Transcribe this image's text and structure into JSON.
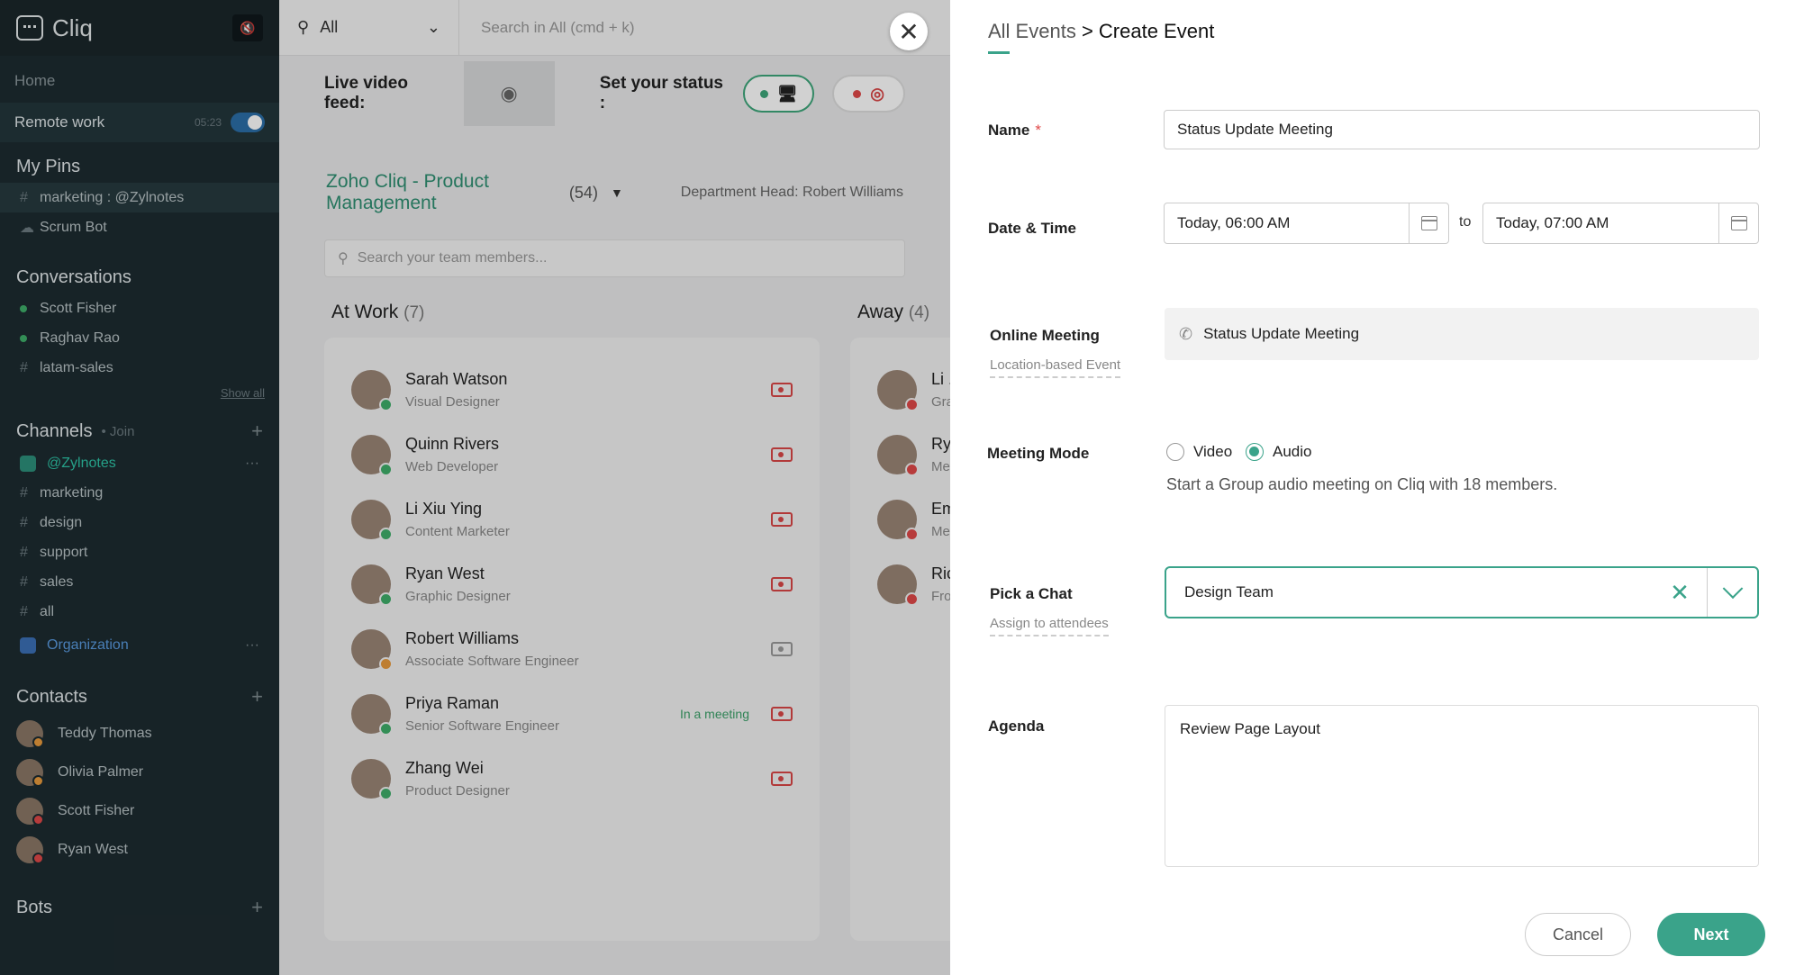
{
  "app": {
    "name": "Cliq"
  },
  "sidebar": {
    "home": "Home",
    "remote": {
      "label": "Remote work",
      "time": "05:23"
    },
    "pins": {
      "title": "My Pins",
      "items": [
        {
          "prefix": "#",
          "label": "marketing : @Zylnotes"
        },
        {
          "prefix": "☁",
          "label": "Scrum Bot"
        }
      ]
    },
    "conversations": {
      "title": "Conversations",
      "items": [
        {
          "label": "Scott Fisher"
        },
        {
          "label": "Raghav Rao"
        },
        {
          "label": "latam-sales"
        }
      ],
      "show_all": "Show all"
    },
    "channels": {
      "title": "Channels",
      "join": "• Join",
      "team": "@Zylnotes",
      "items": [
        "marketing",
        "design",
        "support",
        "sales",
        "all"
      ],
      "org": "Organization"
    },
    "contacts": {
      "title": "Contacts",
      "items": [
        "Teddy Thomas",
        "Olivia Palmer",
        "Scott Fisher",
        "Ryan West"
      ]
    },
    "bots": {
      "title": "Bots"
    }
  },
  "topbar": {
    "scope": "All",
    "search_placeholder": "Search in All (cmd + k)"
  },
  "statusbar": {
    "live_video": "Live video feed:",
    "set_status": "Set your status :"
  },
  "team": {
    "name": "Zoho Cliq - Product Management",
    "count": "(54)",
    "dept": "Department Head: Robert Williams",
    "search_placeholder": "Search your team members..."
  },
  "at_work": {
    "title": "At Work",
    "count": "(7)",
    "members": [
      {
        "name": "Sarah Watson",
        "role": "Visual Designer",
        "status": ""
      },
      {
        "name": "Quinn Rivers",
        "role": "Web Developer",
        "status": ""
      },
      {
        "name": "Li Xiu Ying",
        "role": "Content Marketer",
        "status": ""
      },
      {
        "name": "Ryan West",
        "role": "Graphic Designer",
        "status": ""
      },
      {
        "name": "Robert Williams",
        "role": "Associate Software Engineer",
        "status": ""
      },
      {
        "name": "Priya Raman",
        "role": "Senior Software Engineer",
        "status": "In a meeting"
      },
      {
        "name": "Zhang Wei",
        "role": "Product Designer",
        "status": ""
      }
    ]
  },
  "away": {
    "title": "Away",
    "count": "(4)",
    "members": [
      {
        "name": "Li .",
        "role": "Gra"
      },
      {
        "name": "Ry",
        "role": "Me"
      },
      {
        "name": "Em",
        "role": "Me"
      },
      {
        "name": "Ric",
        "role": "Fro"
      }
    ]
  },
  "panel": {
    "breadcrumb_parent": "All Events",
    "breadcrumb_sep": " > ",
    "breadcrumb_current": "Create Event",
    "name_label": "Name",
    "name_required": "*",
    "name_value": "Status Update Meeting",
    "datetime_label": "Date & Time",
    "start": "Today, 06:00 AM",
    "to": "to",
    "end": "Today, 07:00 AM",
    "online_label": "Online Meeting",
    "location_link": "Location-based Event",
    "online_value": "Status Update Meeting",
    "mode_label": "Meeting Mode",
    "mode_video": "Video",
    "mode_audio": "Audio",
    "mode_selected": "Audio",
    "mode_desc": "Start a Group audio meeting on Cliq with 18 members.",
    "chat_label": "Pick a Chat",
    "assign_link": "Assign to attendees",
    "chat_value": "Design Team",
    "agenda_label": "Agenda",
    "agenda_value": "Review Page Layout",
    "cancel": "Cancel",
    "next": "Next"
  }
}
